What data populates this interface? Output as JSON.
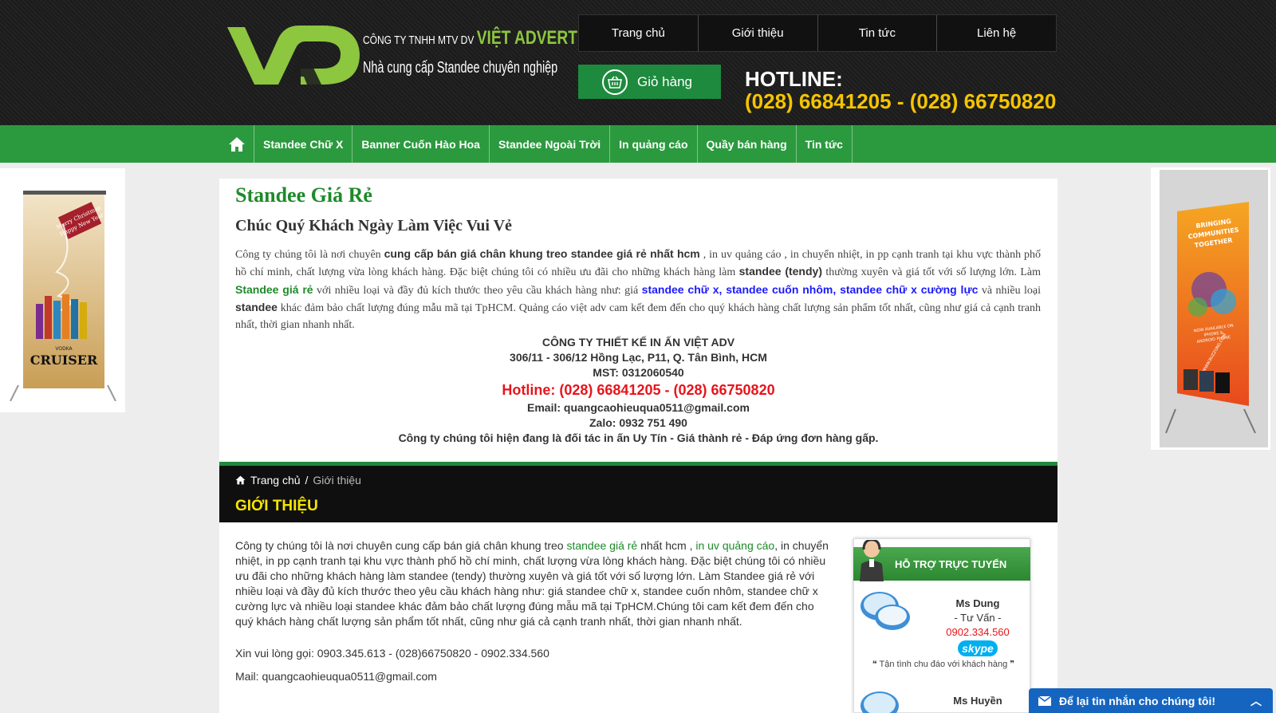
{
  "header": {
    "logo_letters": "VAD",
    "company_prefix": "CÔNG TY TNHH MTV DV",
    "company_name": "VIỆT ADVERTISING",
    "tagline": "Nhà cung cấp Standee chuyên nghiệp",
    "top_nav": [
      "Trang chủ",
      "Giới thiệu",
      "Tin tức",
      "Liên hệ"
    ],
    "cart_label": "Giỏ hàng",
    "hotline_label": "HOTLINE:",
    "hotline_numbers": "(028) 66841205 - (028) 66750820"
  },
  "main_nav": {
    "items": [
      "Standee Chữ X",
      "Banner Cuốn Hào Hoa",
      "Standee Ngoài Trời",
      "In quảng cáo",
      "Quầy bán hàng",
      "Tin tức"
    ]
  },
  "side_banners": {
    "left_text": [
      "Merry Christmas",
      "Happy New Year",
      "VODKA",
      "CRUISER"
    ],
    "right_text": [
      "BRINGING",
      "COMMUNITIES",
      "TOGETHER",
      "NOW AVAILABLE ON",
      "IPHONE &",
      "ANDROID PHONE",
      "WWW.BUZZONG.COM"
    ]
  },
  "content": {
    "title": "Standee Giá Rẻ",
    "subtitle": "Chúc Quý Khách Ngày Làm Việc Vui Vẻ",
    "para": {
      "p1": "Công ty chúng tôi là nơi chuyên ",
      "b1": "cung cấp bán giá chân khung treo standee giá rẻ nhất hcm",
      "p2": " , in uv quảng cáo , in chuyển nhiệt, in pp cạnh tranh tại khu vực thành phố hồ chí minh, chất lượng vừa lòng khách hàng. Đặc biệt chúng tôi có nhiều ưu đãi cho những khách hàng làm ",
      "b2": "standee (tendy)",
      "p3": " thường xuyên và giá tốt với số lượng lớn. Làm ",
      "g1": "Standee giá rẻ",
      "p4": " với nhiều loại và đầy đủ kích thước theo yêu cầu khách hàng như: giá ",
      "bl1": "standee chữ x, standee cuốn nhôm, standee chữ x cường lực",
      "p5": " và nhiều loại ",
      "b3": "standee",
      "p6": " khác đảm bảo chất lượng đúng mẫu mã tại TpHCM. Quảng cáo việt adv cam kết đem đến cho quý khách hàng chất lượng sản phẩm tốt nhất, cũng như giá cả cạnh tranh nhất, thời gian nhanh nhất."
    },
    "company_block": {
      "name": "CÔNG TY THIẾT KẾ IN ẤN VIỆT ADV",
      "address": "306/11 - 306/12 Hồng Lạc, P11, Q. Tân Bình, HCM",
      "mst": "MST: 0312060540",
      "hotline": "Hotline: (028) 66841205 - (028) 66750820",
      "email": "Email: quangcaohieuqua0511@gmail.com",
      "zalo": "Zalo: 0932 751 490",
      "slogan": "Công ty chúng tôi hiện đang là đối tác in ấn Uy Tín - Giá thành rẻ - Đáp ứng đơn hàng gấp."
    }
  },
  "breadcrumb": {
    "home": "Trang chủ",
    "separator": "/",
    "current": "Giới thiệu"
  },
  "section_title": "GIỚI THIỆU",
  "intro": {
    "t1": "Công ty chúng tôi là nơi chuyên cung cấp bán giá chân khung treo ",
    "l1": "standee giá rẻ",
    "t2": " nhất hcm , ",
    "l2": "in uv  quảng cáo",
    "t3": ", in chuyển nhiệt, in pp cạnh tranh tại khu vực thành phố hồ chí minh, chất lượng vừa lòng khách hàng. Đặc biệt chúng tôi có nhiều ưu đãi cho những khách hàng làm standee (tendy) thường xuyên và giá tốt với số lượng lớn. Làm Standee giá rẻ với nhiều loại và đầy đủ kích thước theo yêu cầu khách hàng như: giá standee chữ x, standee cuốn nhôm, standee chữ x cường lực và nhiều loại standee khác đảm bảo chất lượng đúng mẫu mã tại TpHCM.Chúng tôi cam kết đem đến cho quý khách hàng chất lượng sản phẩm tốt nhất, cũng như giá cả cạnh tranh nhất, thời gian nhanh nhất.",
    "phone_line": "Xin vui lòng gọi:  0903.345.613 - (028)66750820 - 0902.334.560",
    "mail_line": "Mail:  quangcaohieuqua0511@gmail.com"
  },
  "support": {
    "title": "HỖ TRỢ TRỰC TUYẾN",
    "agents": [
      {
        "name": "Ms Dung",
        "role": "- Tư Vấn -",
        "phone": "0902.334.560",
        "skype": "skype"
      },
      {
        "name": "Ms Huyền"
      }
    ],
    "quote": "Tận tình chu đáo với khách hàng"
  },
  "chat_bar": {
    "label": "Để lại tin nhắn cho chúng tôi!",
    "chevron": "︿"
  },
  "colors": {
    "green": "#2b9a3e",
    "yellow": "#f5c400",
    "red": "#e8141a",
    "blue": "#1565c0"
  }
}
